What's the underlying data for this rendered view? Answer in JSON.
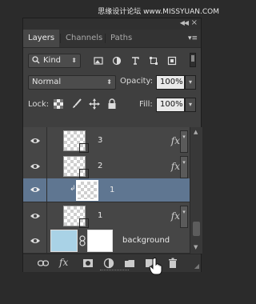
{
  "watermark": "思缘设计论坛 www.MISSYUAN.COM",
  "panel": {
    "tabs": [
      {
        "label": "Layers",
        "active": true
      },
      {
        "label": "Channels",
        "active": false
      },
      {
        "label": "Paths",
        "active": false
      }
    ],
    "filter": {
      "label": "Kind"
    },
    "filter_icons": [
      "image-filter-icon",
      "adjustment-filter-icon",
      "type-filter-icon",
      "shape-filter-icon",
      "smart-object-filter-icon"
    ],
    "blend_mode": "Normal",
    "opacity_label": "Opacity:",
    "opacity_value": "100%",
    "lock_label": "Lock:",
    "fill_label": "Fill:",
    "fill_value": "100%"
  },
  "layers": [
    {
      "name": "3",
      "fx": "fx",
      "selected": false
    },
    {
      "name": "2",
      "fx": "fx",
      "selected": false
    },
    {
      "name": "1",
      "fx": "",
      "selected": true
    },
    {
      "name": "1",
      "fx": "fx",
      "selected": false
    },
    {
      "name": "background",
      "fx": "",
      "selected": false
    }
  ],
  "bottom_fx": "fx",
  "colors": {
    "selected_row": "#5f7691",
    "panel_bg": "#3f3f3f",
    "background_thumb": "#a9d2e6"
  }
}
